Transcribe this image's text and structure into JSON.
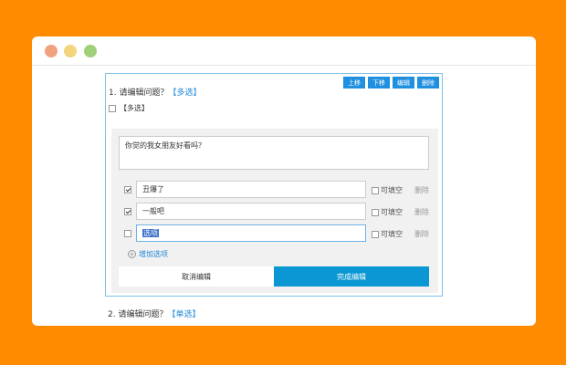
{
  "colors": {
    "background": "#ff8b00",
    "accent": "#1f8fe0",
    "done": "#0b97d3"
  },
  "q1": {
    "title": "1. 请编辑问题？",
    "tag": "【多选】",
    "ops": [
      "上移",
      "下移",
      "编辑",
      "删除"
    ],
    "multi_label": "【多选】",
    "multi_checked": false
  },
  "editor": {
    "question_text": "你觉的我女朋友好看吗？",
    "options": [
      {
        "value": "丑爆了",
        "checked": true,
        "fill_label": "可填空",
        "delete_label": "删除"
      },
      {
        "value": "一般吧",
        "checked": true,
        "fill_label": "可填空",
        "delete_label": "删除"
      },
      {
        "value": "选项",
        "checked": false,
        "fill_label": "可填空",
        "delete_label": "删除"
      }
    ],
    "add_label": "增加选项",
    "cancel_label": "取消编辑",
    "done_label": "完成编辑"
  },
  "q2": {
    "title": "2. 请编辑问题？",
    "tag": "【单选】"
  }
}
